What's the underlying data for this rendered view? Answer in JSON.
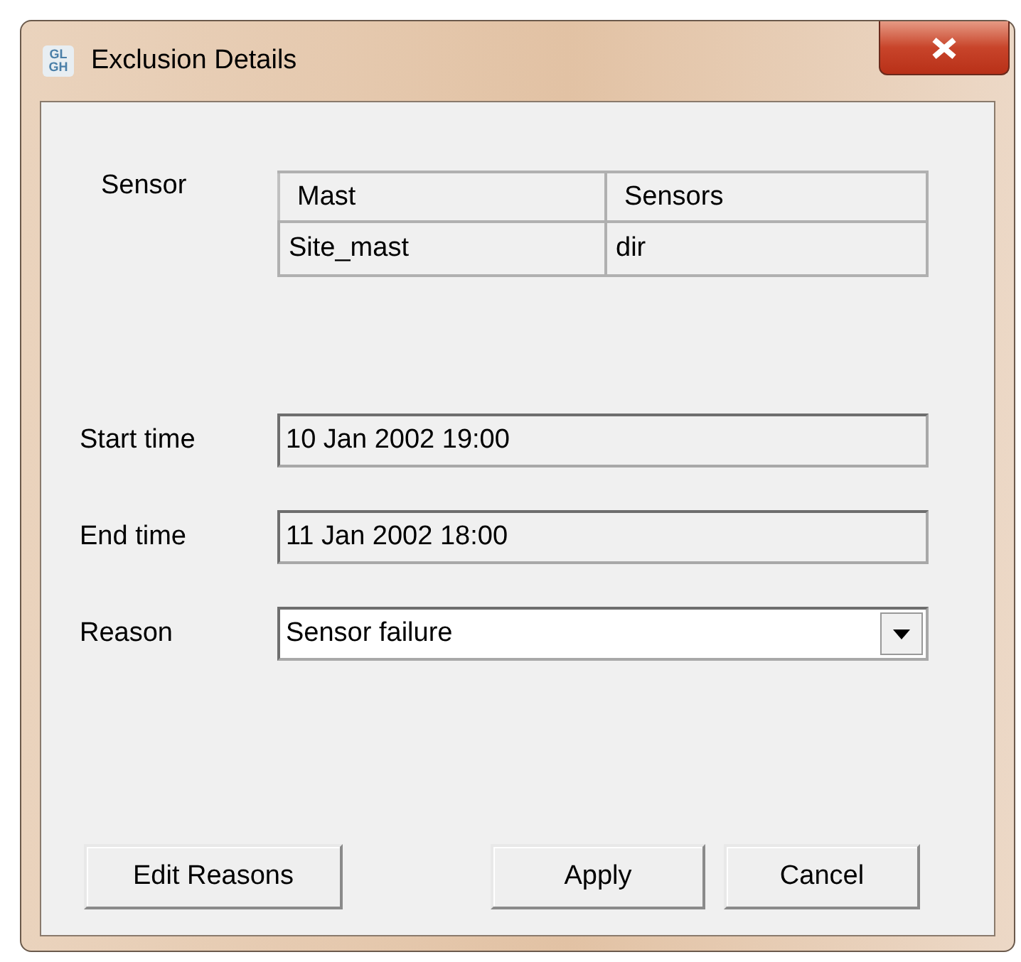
{
  "window": {
    "title": "Exclusion Details",
    "icon_text": [
      "GL",
      "GH"
    ]
  },
  "sensor": {
    "label": "Sensor",
    "table": {
      "columns": [
        "Mast",
        "Sensors"
      ],
      "rows": [
        [
          "Site_mast",
          "dir"
        ]
      ]
    }
  },
  "fields": [
    {
      "kind": "text",
      "label": "Start time",
      "value": "10 Jan 2002 19:00"
    },
    {
      "kind": "text",
      "label": "End time",
      "value": "11 Jan 2002 18:00"
    },
    {
      "kind": "dropdown",
      "label": "Reason",
      "value": "Sensor failure"
    }
  ],
  "buttons": {
    "left": [
      "Edit Reasons"
    ],
    "right": [
      "Apply",
      "Cancel"
    ]
  }
}
